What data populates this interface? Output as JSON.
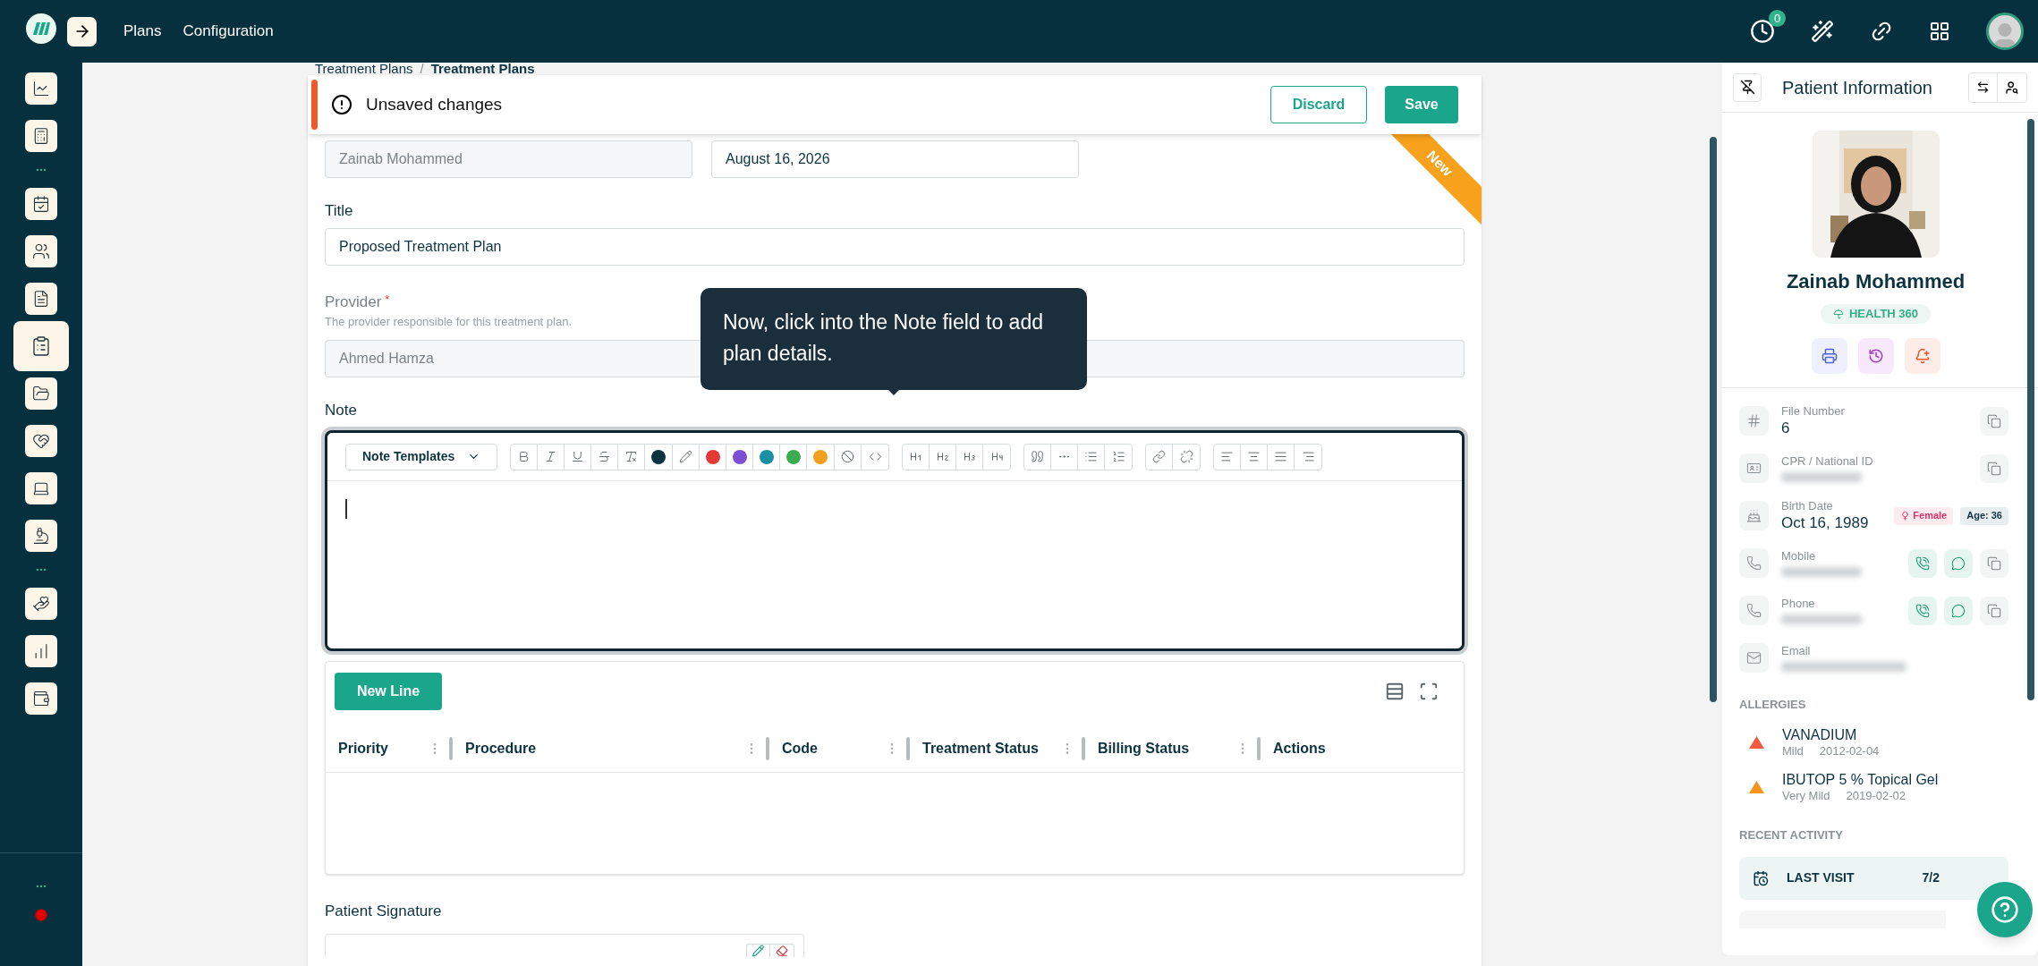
{
  "top_bar": {
    "nav": [
      "Plans",
      "Configuration"
    ],
    "notification_count": "0"
  },
  "sidebar": {
    "items": [
      {
        "kind": "icon",
        "selected": false
      },
      {
        "kind": "icon",
        "selected": false
      },
      {
        "kind": "more"
      },
      {
        "kind": "icon",
        "selected": false
      },
      {
        "kind": "icon",
        "selected": false
      },
      {
        "kind": "icon",
        "selected": false
      },
      {
        "kind": "icon",
        "selected": true
      },
      {
        "kind": "icon",
        "selected": false
      },
      {
        "kind": "icon",
        "selected": false
      },
      {
        "kind": "icon",
        "selected": false
      },
      {
        "kind": "icon",
        "selected": false
      },
      {
        "kind": "more"
      },
      {
        "kind": "icon",
        "selected": false
      },
      {
        "kind": "icon",
        "selected": false
      },
      {
        "kind": "icon",
        "selected": false
      }
    ],
    "footer_more": true,
    "recording": true
  },
  "breadcrumb": {
    "items": [
      "Treatment Plans",
      "Treatment Plans"
    ],
    "separator": "/"
  },
  "unsaved_banner": {
    "message": "Unsaved changes",
    "buttons": [
      {
        "label": "Discard",
        "kind": "outline"
      },
      {
        "label": "Save",
        "kind": "primary"
      }
    ]
  },
  "ribbon": "New",
  "form": {
    "patient": {
      "value": "Zainab Mohammed",
      "disabled": true
    },
    "date": {
      "value": "August 16, 2026",
      "disabled": false
    },
    "title": {
      "label": "Title",
      "value": "Proposed Treatment Plan",
      "disabled": false
    },
    "provider": {
      "label": "Provider",
      "required_mark": "*",
      "hint": "The provider responsible for this treatment plan.",
      "value": "Ahmed Hamza",
      "disabled": true
    },
    "note": {
      "label": "Note",
      "focused": true,
      "template_button": "Note Templates",
      "swatches": [
        {
          "color": "#0d3340"
        },
        {
          "color": "#e53935"
        },
        {
          "color": "#7e4fd6"
        },
        {
          "color": "#1b8fa6"
        },
        {
          "color": "#3bab4f"
        },
        {
          "color": "#f0a01c"
        }
      ]
    }
  },
  "tooltip": "Now, click into the Note field to add plan details.",
  "lines_table": {
    "new_button": "New Line",
    "columns": [
      "Priority",
      "Procedure",
      "Code",
      "Treatment Status",
      "Billing Status",
      "Actions"
    ]
  },
  "signature": {
    "label": "Patient Signature"
  },
  "patient_panel": {
    "title": "Patient Information",
    "name": "Zainab Mohammed",
    "badge": "HEALTH 360",
    "fields": [
      {
        "kind": "number",
        "label": "File Number",
        "value": "6"
      },
      {
        "kind": "id",
        "label": "CPR / National ID",
        "redacted": true
      },
      {
        "kind": "birth",
        "label": "Birth Date",
        "value": "Oct 16, 1989",
        "gender": "Female",
        "age": "Age: 36"
      },
      {
        "kind": "phone",
        "label": "Mobile",
        "redacted": true
      },
      {
        "kind": "phone",
        "label": "Phone",
        "redacted": true
      },
      {
        "kind": "email",
        "label": "Email",
        "redacted": true
      }
    ],
    "allergies_heading": "ALLERGIES",
    "allergies": [
      {
        "name": "VANADIUM",
        "severity": "Mild",
        "date": "2012-02-04",
        "color": "#f15a3a"
      },
      {
        "name": "IBUTOP 5 % Topical Gel",
        "severity": "Very Mild",
        "date": "2019-02-02",
        "color": "#f7941d"
      }
    ],
    "activity_heading": "RECENT ACTIVITY",
    "activity": [
      {
        "label": "LAST VISIT",
        "value": "7/2"
      }
    ]
  }
}
